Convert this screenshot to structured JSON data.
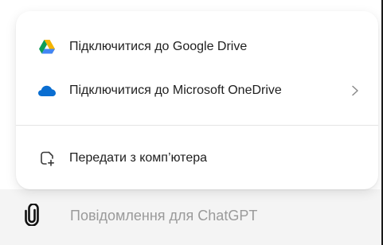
{
  "menu": {
    "items": [
      {
        "label": "Підключитися до Google Drive",
        "icon": "google-drive-icon"
      },
      {
        "label": "Підключитися до Microsoft OneDrive",
        "icon": "onedrive-icon",
        "has_submenu": true
      },
      {
        "label": "Передати з комп’ютера",
        "icon": "upload-from-computer-icon"
      }
    ]
  },
  "composer": {
    "placeholder": "Повідомлення для ChatGPT",
    "attach_icon": "paperclip-icon"
  },
  "colors": {
    "google_drive_green": "#0f9d58",
    "google_drive_yellow": "#f4b400",
    "google_drive_blue": "#4285f4",
    "onedrive_blue": "#0a6ed1",
    "composer_background": "#f4f4f4"
  }
}
